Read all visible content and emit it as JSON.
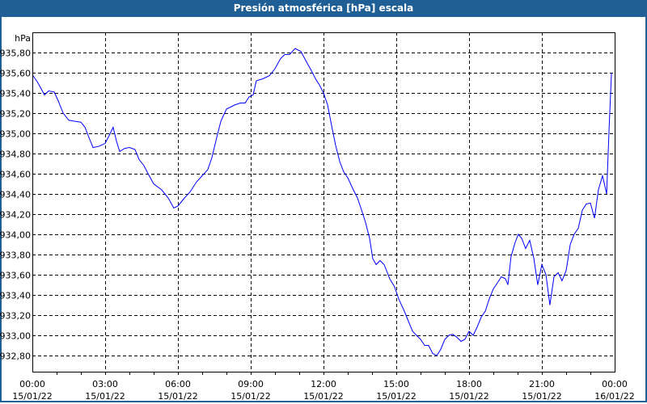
{
  "window": {
    "title": "Presión atmosférica [hPa] escala"
  },
  "chart_data": {
    "type": "line",
    "title": "Presión atmosférica [hPa] escala",
    "ylabel": "hPa",
    "xlabel": "",
    "ylim": [
      932.64,
      936.0
    ],
    "xlim": [
      0,
      24
    ],
    "grid": true,
    "line_color": "#0000ff",
    "yticks": [
      {
        "v": 935.8,
        "label": "935,80"
      },
      {
        "v": 935.6,
        "label": "935,60"
      },
      {
        "v": 935.4,
        "label": "935,40"
      },
      {
        "v": 935.2,
        "label": "935,20"
      },
      {
        "v": 935.0,
        "label": "935,00"
      },
      {
        "v": 934.8,
        "label": "934,80"
      },
      {
        "v": 934.6,
        "label": "934,60"
      },
      {
        "v": 934.4,
        "label": "934,40"
      },
      {
        "v": 934.2,
        "label": "934,20"
      },
      {
        "v": 934.0,
        "label": "934,00"
      },
      {
        "v": 933.8,
        "label": "933,80"
      },
      {
        "v": 933.6,
        "label": "933,60"
      },
      {
        "v": 933.4,
        "label": "933,40"
      },
      {
        "v": 933.2,
        "label": "933,20"
      },
      {
        "v": 933.0,
        "label": "933,00"
      },
      {
        "v": 932.8,
        "label": "932,80"
      }
    ],
    "xticks": [
      {
        "h": 0,
        "time": "00:00",
        "date": "15/01/22"
      },
      {
        "h": 3,
        "time": "03:00",
        "date": "15/01/22"
      },
      {
        "h": 6,
        "time": "06:00",
        "date": "15/01/22"
      },
      {
        "h": 9,
        "time": "09:00",
        "date": "15/01/22"
      },
      {
        "h": 12,
        "time": "12:00",
        "date": "15/01/22"
      },
      {
        "h": 15,
        "time": "15:00",
        "date": "15/01/22"
      },
      {
        "h": 18,
        "time": "18:00",
        "date": "15/01/22"
      },
      {
        "h": 21,
        "time": "21:00",
        "date": "15/01/22"
      },
      {
        "h": 24,
        "time": "00:00",
        "date": "16/01/22"
      }
    ],
    "series": [
      {
        "name": "Presión atmosférica",
        "x": [
          0,
          0.23,
          0.5,
          0.67,
          0.9,
          1.07,
          1.27,
          1.5,
          1.73,
          2,
          2.17,
          2.33,
          2.5,
          2.73,
          3,
          3.17,
          3.33,
          3.47,
          3.6,
          3.8,
          4,
          4.23,
          4.4,
          4.6,
          4.77,
          5,
          5.33,
          5.6,
          5.83,
          6,
          6.27,
          6.5,
          6.77,
          7,
          7.23,
          7.4,
          7.6,
          7.77,
          8,
          8.17,
          8.33,
          8.57,
          8.77,
          8.93,
          9.1,
          9.23,
          9.5,
          9.77,
          10,
          10.23,
          10.4,
          10.6,
          10.83,
          11.07,
          11.27,
          11.5,
          11.67,
          11.83,
          12,
          12.17,
          12.33,
          12.5,
          12.67,
          12.83,
          13,
          13.23,
          13.4,
          13.57,
          13.73,
          13.9,
          14.03,
          14.17,
          14.33,
          14.5,
          14.73,
          14.93,
          15.1,
          15.33,
          15.5,
          15.67,
          15.83,
          16,
          16.17,
          16.33,
          16.5,
          16.67,
          16.83,
          17,
          17.17,
          17.33,
          17.5,
          17.67,
          17.83,
          18,
          18.17,
          18.33,
          18.5,
          18.67,
          18.83,
          19,
          19.17,
          19.33,
          19.5,
          19.6,
          19.73,
          19.9,
          20.03,
          20.17,
          20.33,
          20.5,
          20.67,
          20.83,
          21,
          21.17,
          21.33,
          21.5,
          21.67,
          21.83,
          22,
          22.17,
          22.33,
          22.5,
          22.67,
          22.83,
          23,
          23.17,
          23.33,
          23.5,
          23.67,
          23.77,
          23.87
        ],
        "y": [
          935.58,
          935.5,
          935.38,
          935.42,
          935.41,
          935.32,
          935.2,
          935.13,
          935.12,
          935.11,
          935.06,
          934.96,
          934.86,
          934.87,
          934.9,
          934.98,
          935.06,
          934.92,
          934.82,
          934.85,
          934.86,
          934.84,
          934.74,
          934.68,
          934.6,
          934.5,
          934.44,
          934.36,
          934.26,
          934.28,
          934.36,
          934.42,
          934.52,
          934.58,
          934.64,
          934.76,
          934.96,
          935.12,
          935.24,
          935.26,
          935.28,
          935.3,
          935.3,
          935.36,
          935.38,
          935.52,
          935.54,
          935.57,
          935.64,
          935.74,
          935.78,
          935.78,
          935.84,
          935.81,
          935.72,
          935.62,
          935.54,
          935.48,
          935.4,
          935.28,
          935.08,
          934.88,
          934.72,
          934.62,
          934.56,
          934.44,
          934.36,
          934.24,
          934.12,
          933.96,
          933.76,
          933.7,
          933.74,
          933.7,
          933.56,
          933.48,
          933.36,
          933.24,
          933.14,
          933.04,
          933.0,
          932.96,
          932.9,
          932.9,
          932.82,
          932.8,
          932.86,
          932.96,
          933.0,
          933.01,
          932.98,
          932.94,
          932.96,
          933.04,
          933.0,
          933.08,
          933.18,
          933.24,
          933.36,
          933.46,
          933.52,
          933.58,
          933.56,
          933.5,
          933.78,
          933.92,
          934.0,
          933.96,
          933.86,
          933.94,
          933.76,
          933.5,
          933.7,
          933.6,
          933.3,
          933.58,
          933.62,
          933.54,
          933.64,
          933.9,
          934.0,
          934.06,
          934.24,
          934.3,
          934.31,
          934.16,
          934.44,
          934.58,
          934.4,
          935.04,
          935.6
        ]
      }
    ]
  }
}
